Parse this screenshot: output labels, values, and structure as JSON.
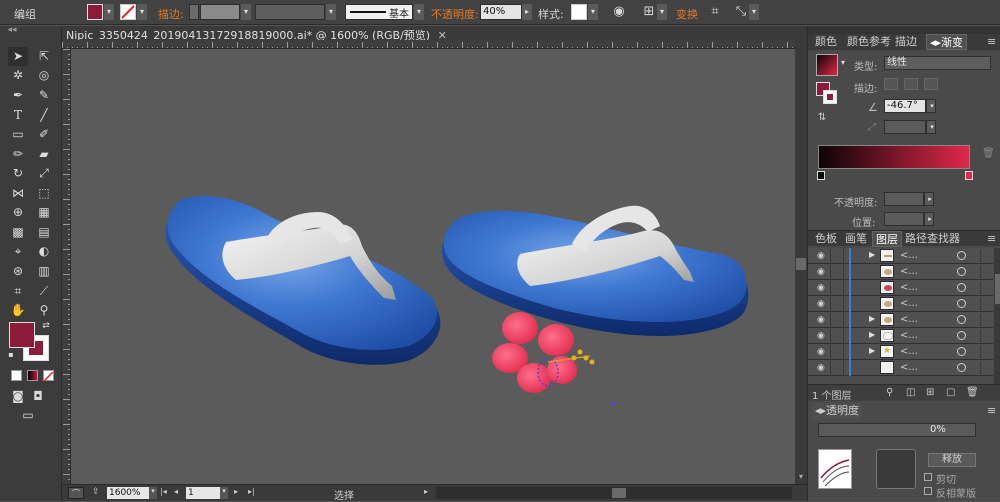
{
  "control_bar": {
    "group_label": "编组",
    "stroke_label": "描边",
    "stroke_profile": "基本",
    "opacity_label": "不透明度",
    "opacity_value": "40%",
    "style_label": "样式",
    "transform_label": "变换",
    "fill_color": "#8c1c3a"
  },
  "document": {
    "tab_title": "Nipic_3350424_20190413172918819000.ai* @ 1600% (RGB/预览)",
    "zoom": "1600%",
    "artboard": "1",
    "status": "选择"
  },
  "panels": {
    "top_tabs": [
      "颜色",
      "颜色参考",
      "描边",
      "渐变"
    ],
    "gradient": {
      "type_label": "类型",
      "type_value": "线性",
      "stroke_label": "描边",
      "angle_value": "-46.7°",
      "opacity_label": "不透明度",
      "position_label": "位置",
      "start_color": "#0d0406",
      "end_color": "#e0284a"
    },
    "mid_tabs": [
      "色板",
      "画笔",
      "图层",
      "路径查找器"
    ],
    "layers": {
      "rows": [
        {
          "name": "<...",
          "expandable": true,
          "thumb": "bar"
        },
        {
          "name": "<...",
          "expandable": false,
          "thumb": "oval"
        },
        {
          "name": "<...",
          "expandable": false,
          "thumb": "oval-red"
        },
        {
          "name": "<...",
          "expandable": false,
          "thumb": "oval"
        },
        {
          "name": "<...",
          "expandable": true,
          "thumb": "oval"
        },
        {
          "name": "<...",
          "expandable": true,
          "thumb": "shape"
        },
        {
          "name": "<...",
          "expandable": true,
          "thumb": "star"
        },
        {
          "name": "<...",
          "expandable": false,
          "thumb": "blank"
        }
      ],
      "footer": "1 个图层"
    },
    "transparency": {
      "tab_label": "透明度",
      "value": "0%",
      "release_label": "释放",
      "clip_label": "剪切",
      "invert_mask_label": "反相蒙版"
    }
  },
  "tools": {
    "fill_color": "#8c1c3a",
    "stroke_color": "#ffffff"
  }
}
